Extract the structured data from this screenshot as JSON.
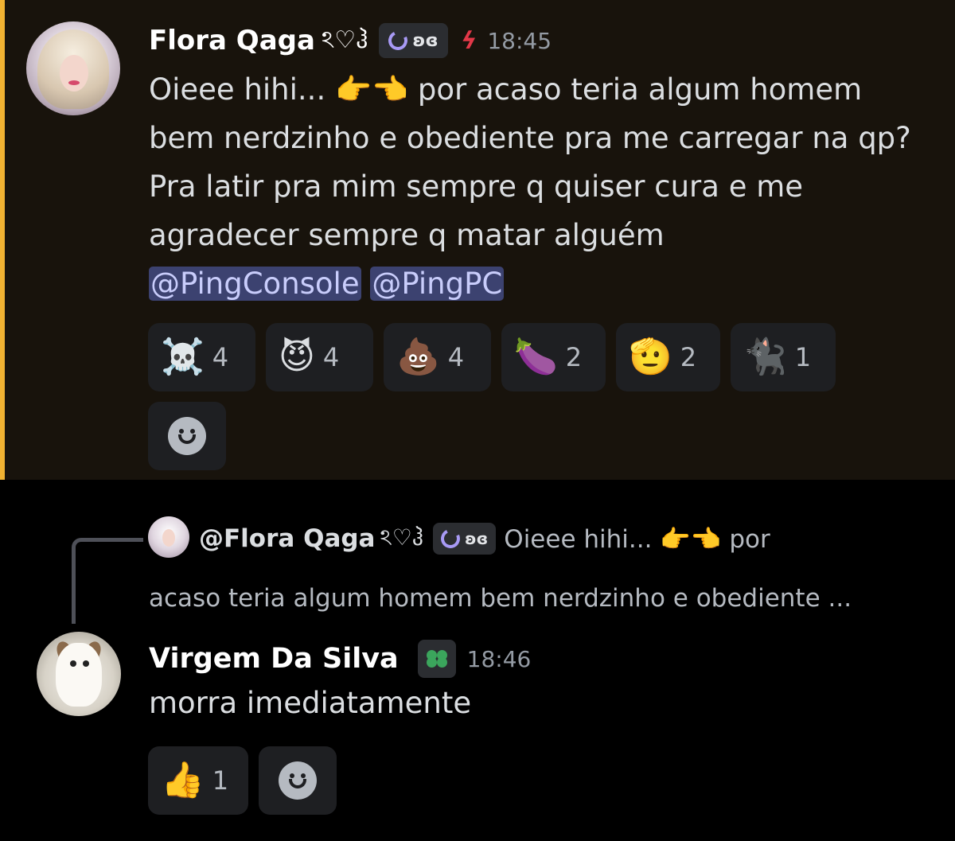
{
  "message1": {
    "username": "Flora Qaga",
    "name_decoration": "ঽ♡ჰ",
    "tag": "ʚɞ",
    "timestamp": "18:45",
    "text_part1": "Oieee hihi... 👉👈 por acaso teria algum homem bem nerdzinho e obediente pra me carregar na qp? Pra latir pra mim sempre q quiser cura e me agradecer sempre q matar alguém",
    "mentions": [
      "@PingConsole",
      "@PingPC"
    ],
    "reactions": [
      {
        "emoji": "☠️",
        "count": "4"
      },
      {
        "emoji": "😈",
        "count": "4"
      },
      {
        "emoji": "💩",
        "count": "4"
      },
      {
        "emoji": "🍆",
        "count": "2"
      },
      {
        "emoji": "🫡",
        "count": "2"
      },
      {
        "emoji": "🐈‍⬛",
        "count": "1"
      }
    ],
    "highlight_color": "#f0b232"
  },
  "reply": {
    "username": "@Flora Qaga",
    "name_decoration": "ঽ♡ჰ",
    "tag": "ʚɞ",
    "preview_line1": "Oieee hihi... 👉👈 por",
    "preview_line2": "acaso teria algum homem bem nerdzinho e obediente ..."
  },
  "message2": {
    "username": "Virgem Da Silva",
    "timestamp": "18:46",
    "text": "morra imediatamente",
    "reactions": [
      {
        "emoji": "👍",
        "count": "1"
      }
    ]
  },
  "icons": {
    "add_reaction": "smile-icon",
    "role_icon": "bolt-icon",
    "guild_tag_icon": "clover-icon"
  }
}
